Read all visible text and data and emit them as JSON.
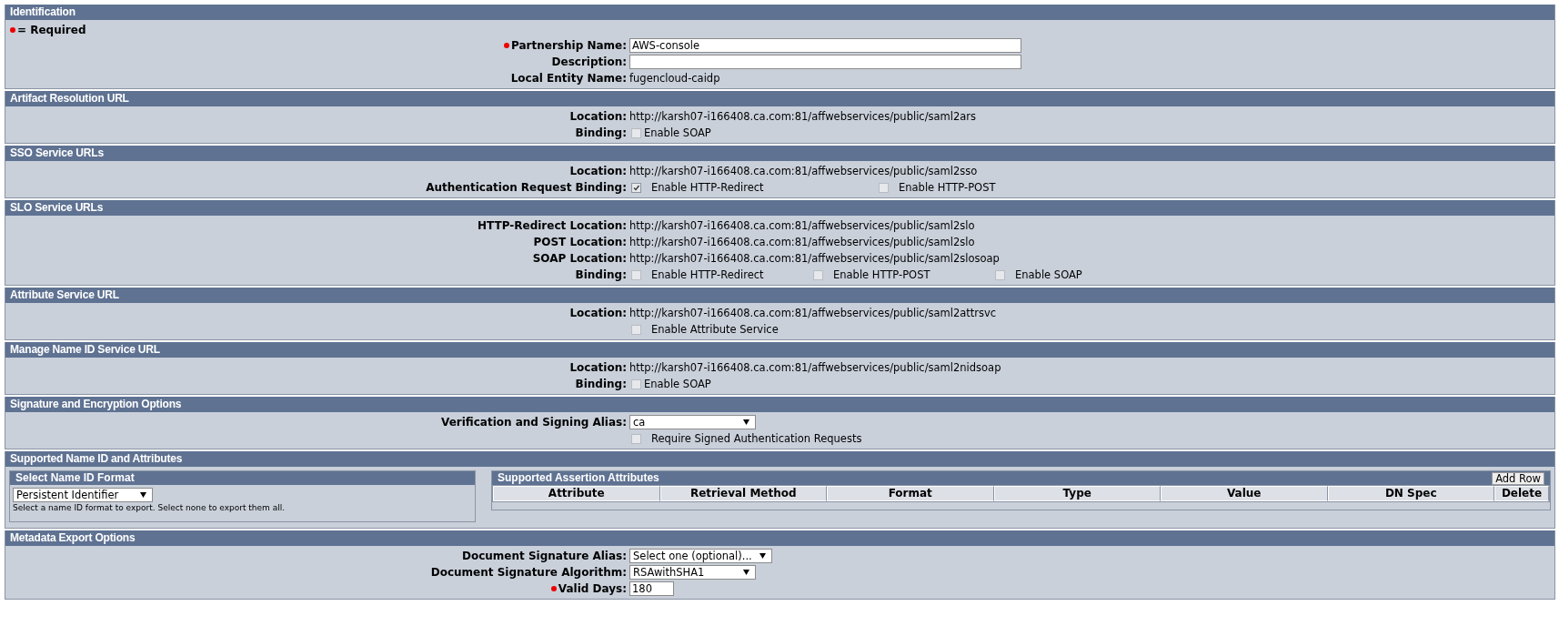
{
  "sections": [
    {
      "title": "Identification",
      "legend": "= Required",
      "rows": [
        {
          "label": "Partnership Name:",
          "required": true,
          "kind": "input",
          "value": "AWS-console"
        },
        {
          "label": "Description:",
          "required": false,
          "kind": "input",
          "value": ""
        },
        {
          "label": "Local Entity Name:",
          "required": false,
          "kind": "text",
          "value": "fugencloud-caidp"
        }
      ]
    },
    {
      "title": "Artifact Resolution URL",
      "rows": [
        {
          "label": "Location:",
          "required": false,
          "kind": "text",
          "value": "http://karsh07-i166408.ca.com:81/affwebservices/public/saml2ars"
        },
        {
          "label": "Binding:",
          "required": false,
          "kind": "checkboxes",
          "options": [
            {
              "label": "Enable SOAP",
              "checked": false
            }
          ]
        }
      ]
    },
    {
      "title": "SSO Service URLs",
      "rows": [
        {
          "label": "Location:",
          "required": false,
          "kind": "text",
          "value": "http://karsh07-i166408.ca.com:81/affwebservices/public/saml2sso"
        },
        {
          "label": "Authentication Request Binding:",
          "required": false,
          "kind": "checkboxes",
          "options": [
            {
              "label": "Enable HTTP-Redirect",
              "checked": true
            },
            {
              "label": "Enable HTTP-POST",
              "checked": false
            }
          ]
        }
      ]
    },
    {
      "title": "SLO Service URLs",
      "rows": [
        {
          "label": "HTTP-Redirect Location:",
          "required": false,
          "kind": "text",
          "value": "http://karsh07-i166408.ca.com:81/affwebservices/public/saml2slo"
        },
        {
          "label": "POST Location:",
          "required": false,
          "kind": "text",
          "value": "http://karsh07-i166408.ca.com:81/affwebservices/public/saml2slo"
        },
        {
          "label": "SOAP Location:",
          "required": false,
          "kind": "text",
          "value": "http://karsh07-i166408.ca.com:81/affwebservices/public/saml2slosoap"
        },
        {
          "label": "Binding:",
          "required": false,
          "kind": "checkboxes",
          "options": [
            {
              "label": "Enable HTTP-Redirect",
              "checked": false
            },
            {
              "label": "Enable HTTP-POST",
              "checked": false
            },
            {
              "label": "Enable SOAP",
              "checked": false
            }
          ]
        }
      ]
    },
    {
      "title": "Attribute Service URL",
      "rows": [
        {
          "label": "Location:",
          "required": false,
          "kind": "text",
          "value": "http://karsh07-i166408.ca.com:81/affwebservices/public/saml2attrsvc"
        },
        {
          "kind": "checkboxes",
          "options": [
            {
              "label": "Enable Attribute Service",
              "checked": false
            }
          ]
        }
      ]
    },
    {
      "title": "Manage Name ID Service URL",
      "rows": [
        {
          "label": "Location:",
          "required": false,
          "kind": "text",
          "value": "http://karsh07-i166408.ca.com:81/affwebservices/public/saml2nidsoap"
        },
        {
          "label": "Binding:",
          "required": false,
          "kind": "checkboxes",
          "options": [
            {
              "label": "Enable SOAP",
              "checked": false
            }
          ]
        }
      ]
    },
    {
      "title": "Signature and Encryption Options",
      "rows": [
        {
          "label": "Verification and Signing Alias:",
          "required": false,
          "kind": "select",
          "value": "ca"
        },
        {
          "kind": "checkboxes",
          "options": [
            {
              "label": "Require Signed Authentication Requests",
              "checked": false
            }
          ]
        }
      ]
    },
    {
      "title": "Supported Name ID and Attributes",
      "name_id": {
        "title": "Select Name ID Format",
        "value": "Persistent Identifier",
        "hint": "Select a name ID format to export. Select none to export them all."
      },
      "attributes": {
        "title": "Supported Assertion Attributes",
        "button": "Add Row",
        "columns": [
          "Attribute",
          "Retrieval Method",
          "Format",
          "Type",
          "Value",
          "DN Spec",
          "Delete"
        ]
      }
    },
    {
      "title": "Metadata Export Options",
      "rows": [
        {
          "label": "Document Signature Alias:",
          "required": false,
          "kind": "select",
          "value": "Select one (optional)..."
        },
        {
          "label": "Document Signature Algorithm:",
          "required": false,
          "kind": "select",
          "value": "RSAwithSHA1"
        },
        {
          "label": "Valid Days:",
          "required": true,
          "kind": "number",
          "value": "180"
        }
      ]
    }
  ]
}
